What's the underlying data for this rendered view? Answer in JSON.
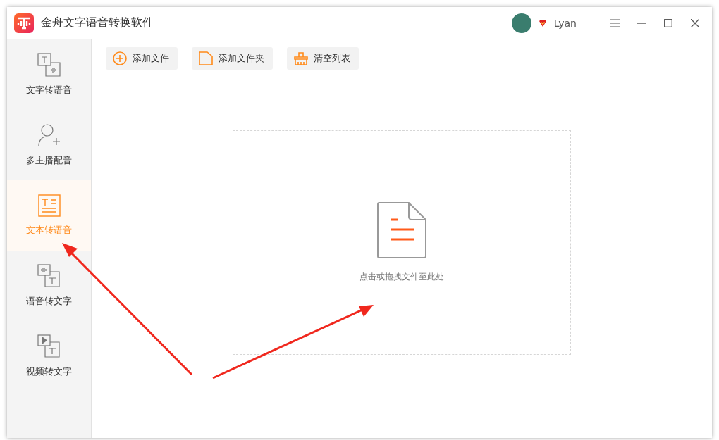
{
  "window": {
    "title": "金舟文字语音转换软件"
  },
  "user": {
    "name": "Lyan"
  },
  "sidebar": {
    "items": [
      {
        "kind": "text-to-speech",
        "label": "文字转语音",
        "selected": false
      },
      {
        "kind": "multi-voice",
        "label": "多主播配音",
        "selected": false
      },
      {
        "kind": "document-to-speech",
        "label": "文本转语音",
        "selected": true
      },
      {
        "kind": "speech-to-text",
        "label": "语音转文字",
        "selected": false
      },
      {
        "kind": "video-to-text",
        "label": "视频转文字",
        "selected": false
      }
    ]
  },
  "toolbar": [
    {
      "kind": "add-file",
      "label": "添加文件"
    },
    {
      "kind": "add-folder",
      "label": "添加文件夹"
    },
    {
      "kind": "clear",
      "label": "清空列表"
    }
  ],
  "drop_zone": {
    "hint": "点击或拖拽文件至此处"
  }
}
